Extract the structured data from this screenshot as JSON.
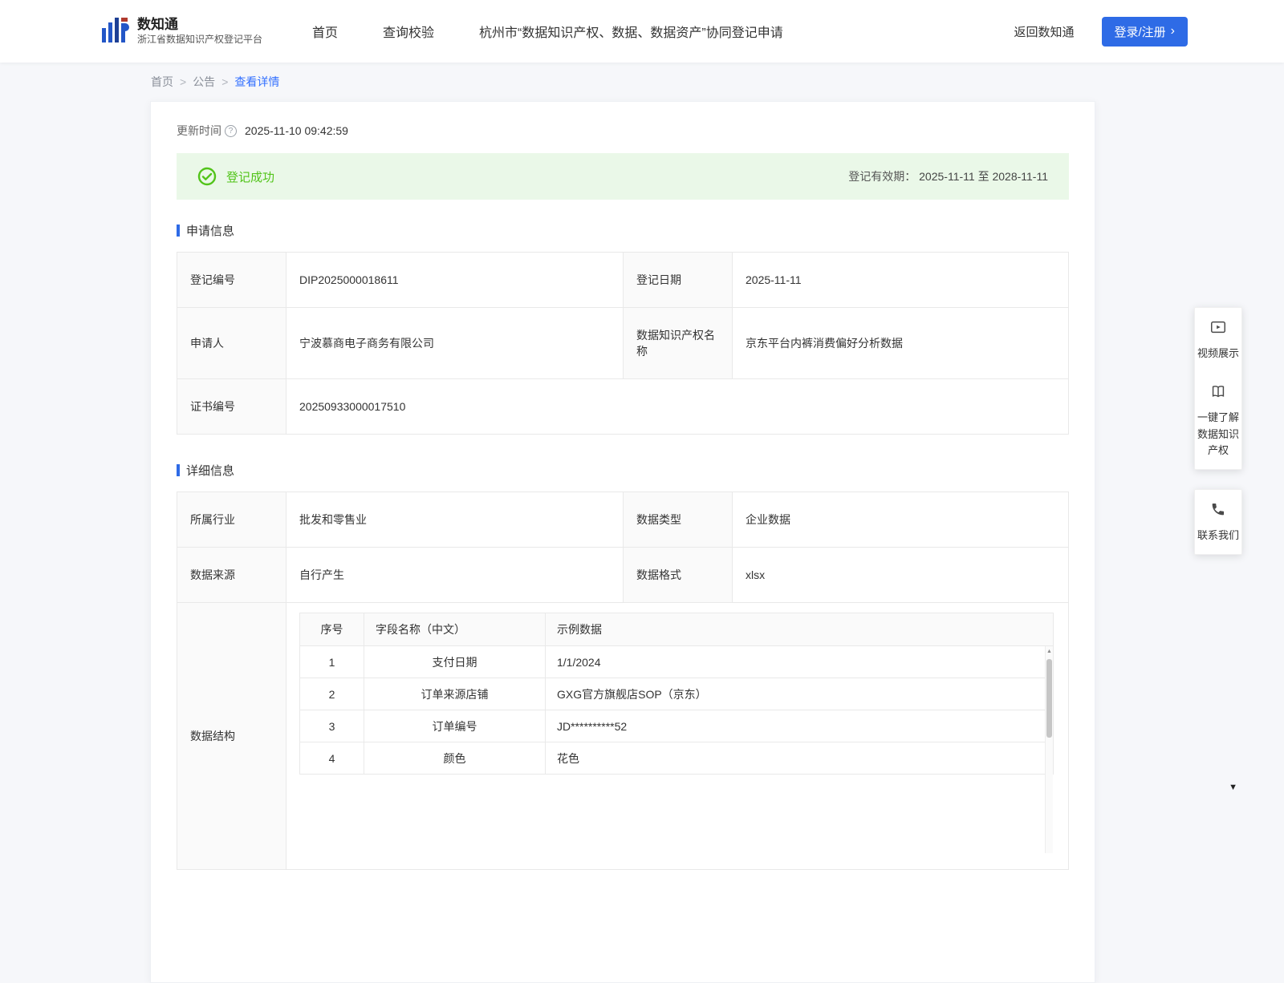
{
  "header": {
    "logo": {
      "title": "数知通",
      "subtitle": "浙江省数据知识产权登记平台"
    },
    "nav": [
      "首页",
      "查询校验",
      "杭州市“数据知识产权、数据、数据资产”协同登记申请"
    ],
    "back_link": "返回数知通",
    "login_label": "登录/注册"
  },
  "breadcrumb": {
    "items": [
      "首页",
      "公告",
      "查看详情"
    ]
  },
  "page": {
    "update_time_label": "更新时间",
    "update_time": "2025-11-10 09:42:59",
    "banner": {
      "status": "登记成功",
      "validity_label": "登记有效期：",
      "validity": "2025-11-11 至 2028-11-11"
    },
    "section_application": "申请信息",
    "section_detail": "详细信息",
    "application": {
      "reg_no_label": "登记编号",
      "reg_no": "DIP2025000018611",
      "reg_date_label": "登记日期",
      "reg_date": "2025-11-11",
      "applicant_label": "申请人",
      "applicant": "宁波慕商电子商务有限公司",
      "ip_name_label": "数据知识产权名称",
      "ip_name": "京东平台内裤消费偏好分析数据",
      "cert_no_label": "证书编号",
      "cert_no": "20250933000017510"
    },
    "details": {
      "industry_label": "所属行业",
      "industry": "批发和零售业",
      "data_type_label": "数据类型",
      "data_type": "企业数据",
      "source_label": "数据来源",
      "source": "自行产生",
      "format_label": "数据格式",
      "format": "xlsx",
      "structure_label": "数据结构"
    },
    "structure_table": {
      "headers": [
        "序号",
        "字段名称（中文）",
        "示例数据"
      ],
      "rows": [
        [
          "1",
          "支付日期",
          "1/1/2024"
        ],
        [
          "2",
          "订单来源店铺",
          "GXG官方旗舰店SOP（京东）"
        ],
        [
          "3",
          "订单编号",
          "JD**********52"
        ],
        [
          "4",
          "颜色",
          "花色"
        ]
      ]
    }
  },
  "floating_panel": {
    "items": [
      "视频展示",
      "一键了解数据知识产权",
      "联系我们"
    ]
  },
  "icons": {
    "help": "?",
    "chevron_right": "›",
    "up_arrow": "▲",
    "down_arrow": "▼"
  },
  "colors": {
    "accent": "#2e6be6",
    "success": "#52c41a",
    "success_bg": "#eaf8e8"
  }
}
